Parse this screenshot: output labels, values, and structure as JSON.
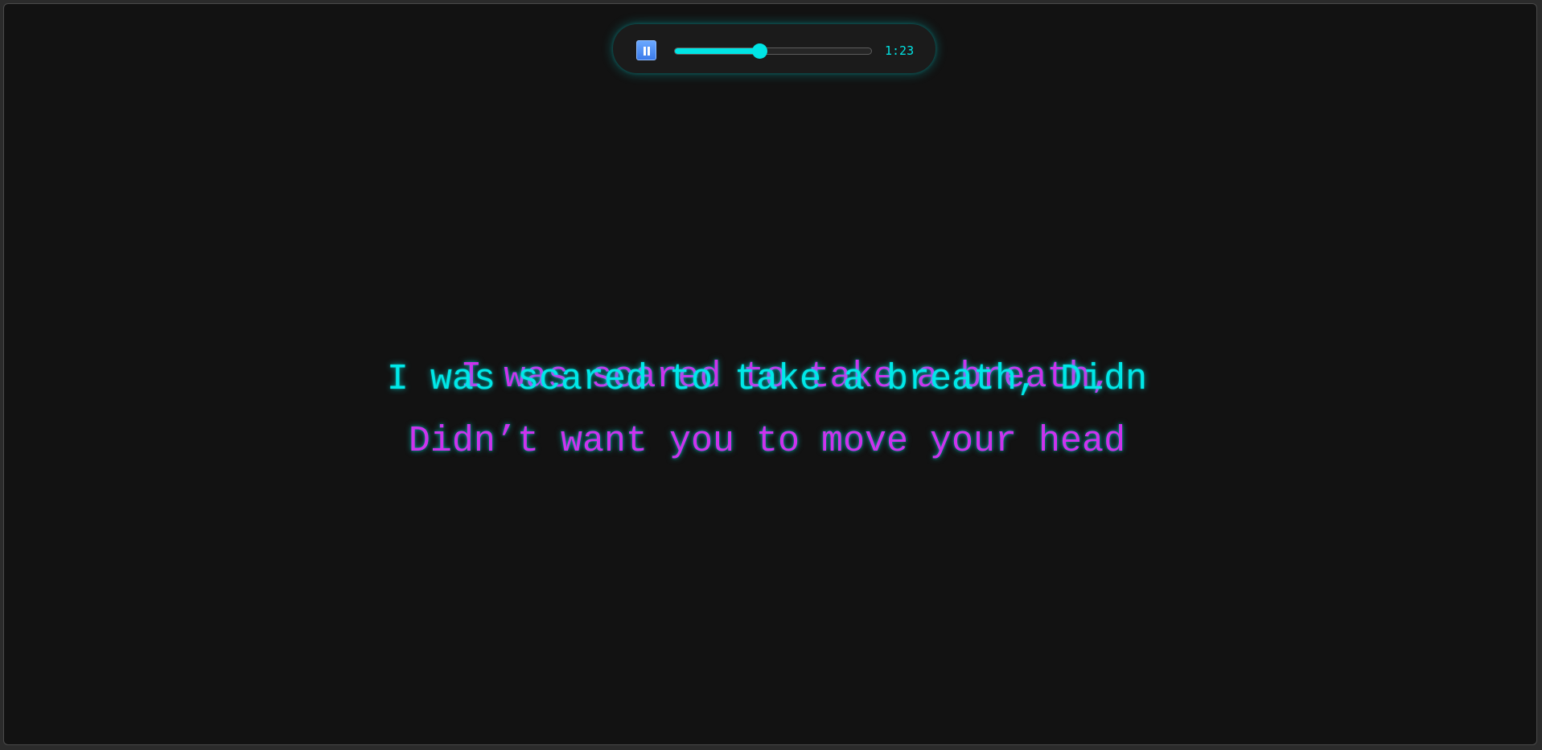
{
  "player": {
    "state_icon": "pause-icon",
    "progress": 0.43,
    "time": "1:23",
    "accent_color": "#00e5e5",
    "button_color": "#3c7bea"
  },
  "lyrics": {
    "ghost_line": "I was scared to take a breath,",
    "current_line": "I was scared to take a breath, Didn",
    "next_line": "Didn’t want you to move your head",
    "cyan_color": "#00e8e8",
    "magenta_color": "#cc33ee"
  }
}
